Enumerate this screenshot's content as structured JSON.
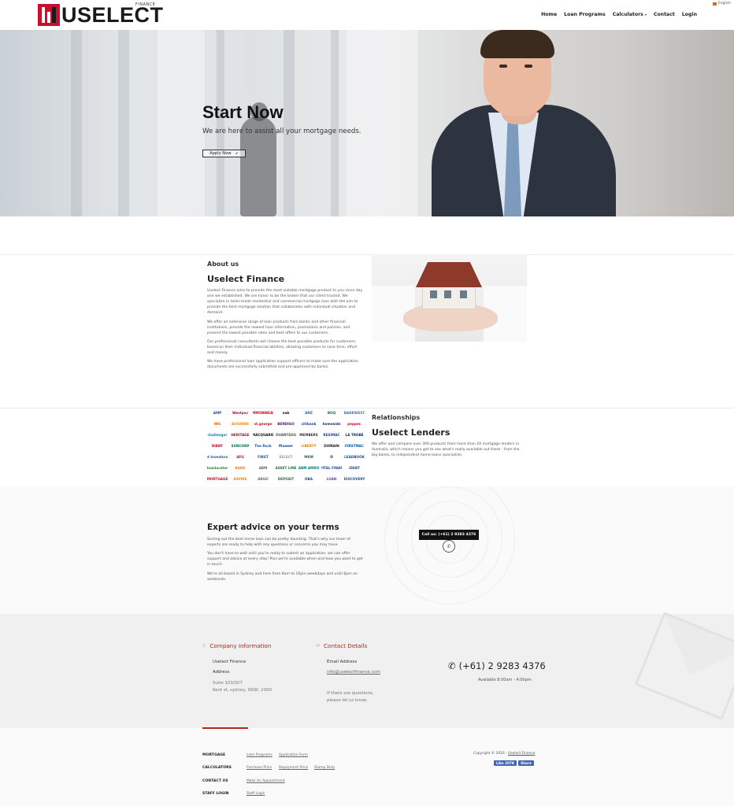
{
  "header": {
    "logo_text": "USELECT",
    "logo_sub": "FINANCE",
    "language": "English",
    "nav": [
      "Home",
      "Loan Programs",
      "Calculators",
      "Contact",
      "Login"
    ]
  },
  "hero": {
    "title": "Start Now",
    "subtitle": "We are here to assist all your mortgage needs.",
    "button": "Apply Now"
  },
  "about": {
    "label": "About us",
    "title": "Uselect Finance",
    "paragraphs": [
      "Uselect Finance aims to provide the most suitable mortgage product to you since day one we established. We are honor to be the broker that our client trusted. We specialize in tailor-made residential and commercial mortgage loan with the aim to provide the best mortgage solution that collaborates with individual situation and demand.",
      "We offer an extensive range of loan products from banks and other financial institutions, provide the newest loan information, promotions and policies, and present the lowest possible rates and best offers to our customers.",
      "Our professional consultants will choose the best possible products for customers, based on their individual financial abilities, allowing customers to save time, effort and money.",
      "We have professional loan application support officers to make sure the application documents are successfully submitted and pre-approved by banks."
    ]
  },
  "lenders": [
    {
      "name": "AMP",
      "color": "#1f4e9c"
    },
    {
      "name": "Westpac",
      "color": "#d5002b"
    },
    {
      "name": "COMMONWEALTH",
      "color": "#e2001a"
    },
    {
      "name": "nab",
      "color": "#111111"
    },
    {
      "name": "ANZ",
      "color": "#0b72b5"
    },
    {
      "name": "BOQ",
      "color": "#2e6b3a"
    },
    {
      "name": "BANKWEST",
      "color": "#3a7bbf"
    },
    {
      "name": "ING",
      "color": "#ff6200"
    },
    {
      "name": "AUSWIDE",
      "color": "#ef8c1a"
    },
    {
      "name": "st.george",
      "color": "#c8102e"
    },
    {
      "name": "BENDIGO",
      "color": "#4a1f5e"
    },
    {
      "name": "citibank",
      "color": "#0f4b8f"
    },
    {
      "name": "homeside",
      "color": "#1c2f6b"
    },
    {
      "name": "pepper.",
      "color": "#c8102e"
    },
    {
      "name": "challenger",
      "color": "#1b75bc"
    },
    {
      "name": "HERITAGE",
      "color": "#7a1f2b"
    },
    {
      "name": "MACQUARIE",
      "color": "#111111"
    },
    {
      "name": "ADVANTEDGE",
      "color": "#555555"
    },
    {
      "name": "MEMBERS",
      "color": "#333333"
    },
    {
      "name": "RESIMAC",
      "color": "#1c3f94"
    },
    {
      "name": "LA TROBE",
      "color": "#0a2a5e"
    },
    {
      "name": "BIBBY",
      "color": "#c8102e"
    },
    {
      "name": "SUNCORP",
      "color": "#006f44"
    },
    {
      "name": "The Rock",
      "color": "#1f4e9c"
    },
    {
      "name": "Pioneer",
      "color": "#0b3d91"
    },
    {
      "name": "LIBERTY",
      "color": "#ef7d00"
    },
    {
      "name": "DOMAIN",
      "color": "#1a1a1a"
    },
    {
      "name": "FIRSTMAC",
      "color": "#005aa7"
    },
    {
      "name": "Provident Investors Finance",
      "color": "#2f5597"
    },
    {
      "name": "AFG",
      "color": "#c8102e"
    },
    {
      "name": "FIRST",
      "color": "#1f4e9c"
    },
    {
      "name": "SELECT",
      "color": "#999999"
    },
    {
      "name": "MKM",
      "color": "#2e6b3a"
    },
    {
      "name": "O",
      "color": "#222222"
    },
    {
      "name": "LEADBOOK",
      "color": "#1f4e9c"
    },
    {
      "name": "loanlocator",
      "color": "#2e7d32"
    },
    {
      "name": "BANK",
      "color": "#ef8c1a"
    },
    {
      "name": "ABM",
      "color": "#666666"
    },
    {
      "name": "ASSET LINE",
      "color": "#2e6b3a"
    },
    {
      "name": "ABM AMRO",
      "color": "#00806a"
    },
    {
      "name": "CAPITAL FINANCE",
      "color": "#1f4e9c"
    },
    {
      "name": "iDEBT",
      "color": "#1f4e9c"
    },
    {
      "name": "MORTGAGE",
      "color": "#c8102e"
    },
    {
      "name": "ASPIRE",
      "color": "#ef8c1a"
    },
    {
      "name": "ARGO",
      "color": "#666666"
    },
    {
      "name": "DEPOSIT",
      "color": "#2e6b3a"
    },
    {
      "name": "DBA",
      "color": "#1f4e9c"
    },
    {
      "name": "LOAN",
      "color": "#6a4c93"
    },
    {
      "name": "DISCOVERY",
      "color": "#1f4e9c"
    }
  ],
  "relationships": {
    "label": "Relationships",
    "title": "Uselect Lenders",
    "text": "We offer and compare over 300 products from more than 20 mortgage lenders in Australia, which means you get to see what's really available out there - from the big banks, to independent home loans specialists."
  },
  "expert": {
    "title": "Expert advice on your terms",
    "paragraphs": [
      "Sorting out the best home loan can be pretty daunting. That's why our team of experts are ready to help with any questions or concerns you may have.",
      "You don't have to wait until you're ready to submit an application, we can offer support and advice at every step! Plus we're available when and how you want to get in touch.",
      "We're all based in Sydney and here from 8am to 10pm weekdays and until 6pm on weekends."
    ],
    "call_badge": "Call us: (+61) 2 9283 4376"
  },
  "footer": {
    "company_heading": "Company Information",
    "company_name": "Uselect Finance",
    "address_label": "Address",
    "address_line1": "Suite 103/507",
    "address_line2": "Kent st, sydney, NSW, 2000",
    "contact_heading": "Contact Details",
    "email_label": "Email Address",
    "email": "info@uselectfinance.com",
    "questions_line1": "If there are questions,",
    "questions_line2": "please let us know.",
    "phone": "(+61) 2 9283 4376",
    "hours": "Available 8:00am - 4:00pm"
  },
  "bottom": {
    "mortgage_label": "MORTGAGE",
    "mortgage_links": [
      "Loan Programs",
      "Application Form"
    ],
    "calculators_label": "CALCULATORS",
    "calculator_links": [
      "Purchase Price",
      "Repayment Price",
      "Stamp Duty"
    ],
    "contact_label": "CONTACT US",
    "contact_link": "Make An Appointment",
    "staff_label": "STAFF LOGIN",
    "staff_link": "Staff Login",
    "copyright_prefix": "Copyright © 2016 ·",
    "copyright_link": "Uselect Finance",
    "fb_like": "Like 207K",
    "fb_share": "Share"
  }
}
